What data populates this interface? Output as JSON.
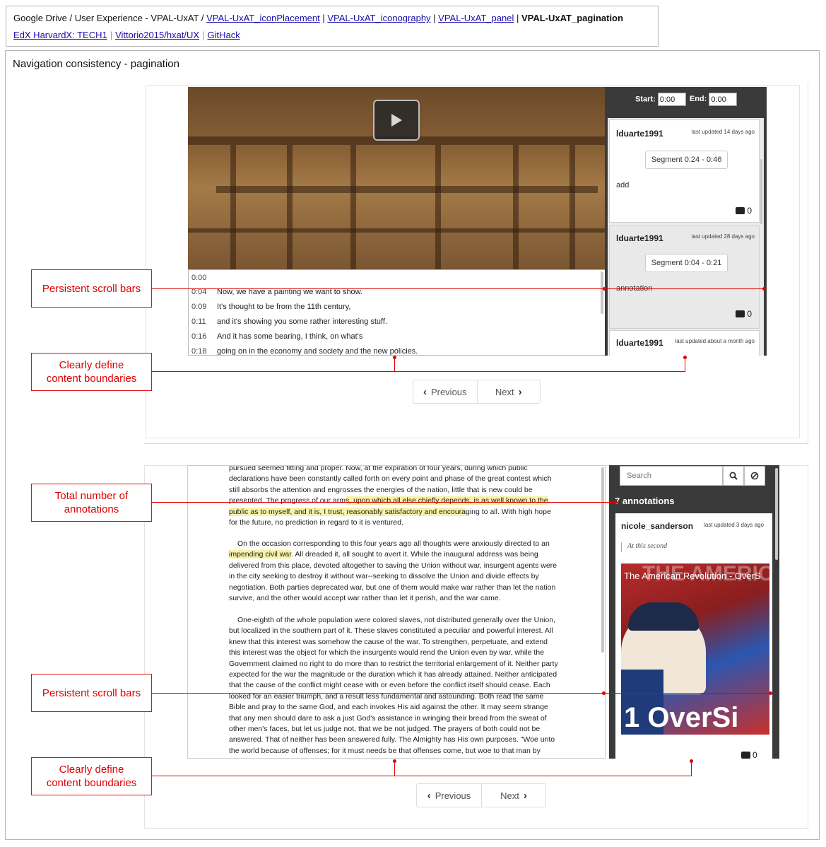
{
  "nav": {
    "crumb_prefix": "Google Drive / User Experience - VPAL-UxAT / ",
    "crumb_links": [
      "VPAL-UxAT_iconPlacement",
      "VPAL-UxAT_iconography",
      "VPAL-UxAT_panel"
    ],
    "crumb_separator": " | ",
    "crumb_current": "VPAL-UxAT_pagination",
    "links": [
      "EdX HarvardX: TECH1",
      "Vittorio2015/hxat/UX",
      "GitHack"
    ]
  },
  "section_title": "Navigation consistency - pagination",
  "callouts": {
    "persistent_scroll_bars": "Persistent scroll bars",
    "content_boundaries_line1": "Clearly define",
    "content_boundaries_line2": "content boundaries",
    "total_annotations_line1": "Total number of",
    "total_annotations_line2": "annotations"
  },
  "pager": {
    "previous": "Previous",
    "next": "Next"
  },
  "shot1": {
    "start_label": "Start:",
    "start_value": "0:00",
    "end_label": "End:",
    "end_value": "0:00",
    "transcript": [
      {
        "time": "0:00",
        "text": ""
      },
      {
        "time": "0:04",
        "text": "Now, we have a painting we want to show."
      },
      {
        "time": "0:09",
        "text": "It's thought to be from the 11th century,"
      },
      {
        "time": "0:11",
        "text": "and it's showing you some rather interesting stuff."
      },
      {
        "time": "0:16",
        "text": "And it has some bearing, I think, on what's"
      },
      {
        "time": "0:18",
        "text": "going on in the economy and society and the new policies."
      }
    ],
    "annotations": [
      {
        "user": "lduarte1991",
        "updated": "last updated 14 days ago",
        "segment": "Segment 0:24 - 0:46",
        "text": "add",
        "comments": "0"
      },
      {
        "user": "lduarte1991",
        "updated": "last updated 28 days ago",
        "segment": "Segment 0:04 - 0:21",
        "text": "annotation",
        "comments": "0"
      },
      {
        "user": "lduarte1991",
        "updated": "last updated about a month ago"
      }
    ]
  },
  "shot2": {
    "search_placeholder": "Search",
    "annotation_count": "7 annotations",
    "card": {
      "user": "nicole_sanderson",
      "updated": "last updated 3 days ago",
      "quote": "At this second",
      "video_title": "The American Revolution - OverS",
      "thumb_big": "THE AMERICA",
      "thumb_brand": "1  OverSi",
      "comments": "0"
    },
    "para1": [
      "pursued seemed fitting and proper. Now, at the expiration of four years, during which public",
      "declarations have been constantly called forth on every point and phase of the great contest which",
      "still absorbs the attention and engrosses the energies of the nation, little that is new could be"
    ],
    "para1_l4a": "presented. The progress of our arm",
    "para1_l4b": "s, upon which all else chiefly depends, is as well known to the",
    "para1_l5a": "public as to myself, and it is, I trust, reasonably satisfactory and encoura",
    "para1_l5b": "ging to all. With high hope",
    "para1_l6": "for the future, no prediction in regard to it is ventured.",
    "para2_l1": "On the occasion corresponding to this four years ago all thoughts were anxiously directed to an",
    "para2_l2a": "impending civil war",
    "para2_l2b": ". All dreaded it, all sought to avert it. While the inaugural address was being",
    "para2": [
      "delivered from this place, devoted altogether to saving the Union without war, insurgent agents were",
      "in the city seeking to destroy it without war--seeking to dissolve the Union and divide effects by",
      "negotiation. Both parties deprecated war, but one of them would make war rather than let the nation",
      "survive, and the other would accept war rather than let it perish, and the war came."
    ],
    "para3": [
      "One-eighth of the whole population were colored slaves, not distributed generally over the Union,",
      "but localized in the southern part of it. These slaves constituted a peculiar and powerful interest. All",
      "knew that this interest was somehow the cause of the war. To strengthen, perpetuate, and extend",
      "this interest was the object for which the insurgents would rend the Union even by war, while the",
      "Government claimed no right to do more than to restrict the territorial enlargement of it. Neither party",
      "expected for the war the magnitude or the duration which it has already attained. Neither anticipated",
      "that the cause of the conflict might cease with or even before the conflict itself should cease. Each",
      "looked for an easier triumph, and a result less fundamental and astounding. Both read the same",
      "Bible and pray to the same God, and each invokes His aid against the other. It may seem strange",
      "that any men should dare to ask a just God's assistance in wringing their bread from the sweat of",
      "other men's faces, but let us judge not, that we be not judged. The prayers of both could not be",
      "answered. That of neither has been answered fully. The Almighty has His own purposes. \"Woe unto",
      "the world because of offenses; for it must needs be that offenses come, but woe to that man by"
    ]
  }
}
